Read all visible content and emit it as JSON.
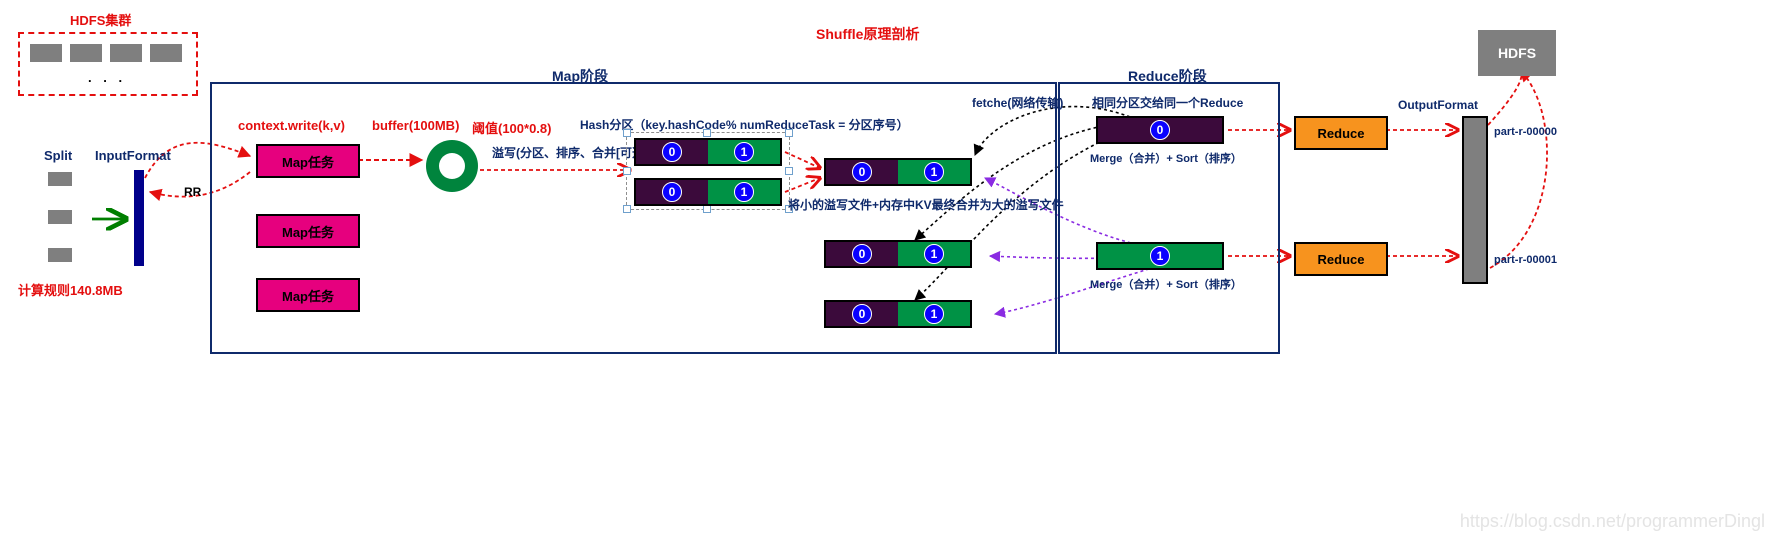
{
  "title": "Shuffle原理剖析",
  "hdfs_cluster_label": "HDFS集群",
  "hdfs_ellipsis": ". . .",
  "split_label": "Split",
  "input_format": "InputFormat",
  "rr_label": "RR",
  "calc_rule": "计算规则140.8MB",
  "map_stage": "Map阶段",
  "reduce_stage": "Reduce阶段",
  "context_write": "context.write(k,v)",
  "buffer_label": "buffer(100MB)",
  "threshold_label": "阈值(100*0.8)",
  "hash_partition": "Hash分区（key.hashCode% numReduceTask = 分区序号）",
  "spill_desc": "溢写(分区、排序、合并[可选])",
  "small_spill": "将小的溢写文件+内存中KV最终合并为大的溢写文件",
  "fetch_label": "fetche(网络传输)",
  "same_part_reduce": "相同分区交给同一个Reduce",
  "merge_sort": "Merge（合并）+ Sort（排序）",
  "output_format": "OutputFormat",
  "part_r0": "part-r-00000",
  "part_r1": "part-r-00001",
  "maptask": "Map任务",
  "reduce": "Reduce",
  "hdfs": "HDFS",
  "p0": "0",
  "p1": "1",
  "watermark": "https://blog.csdn.net/programmerDingl"
}
